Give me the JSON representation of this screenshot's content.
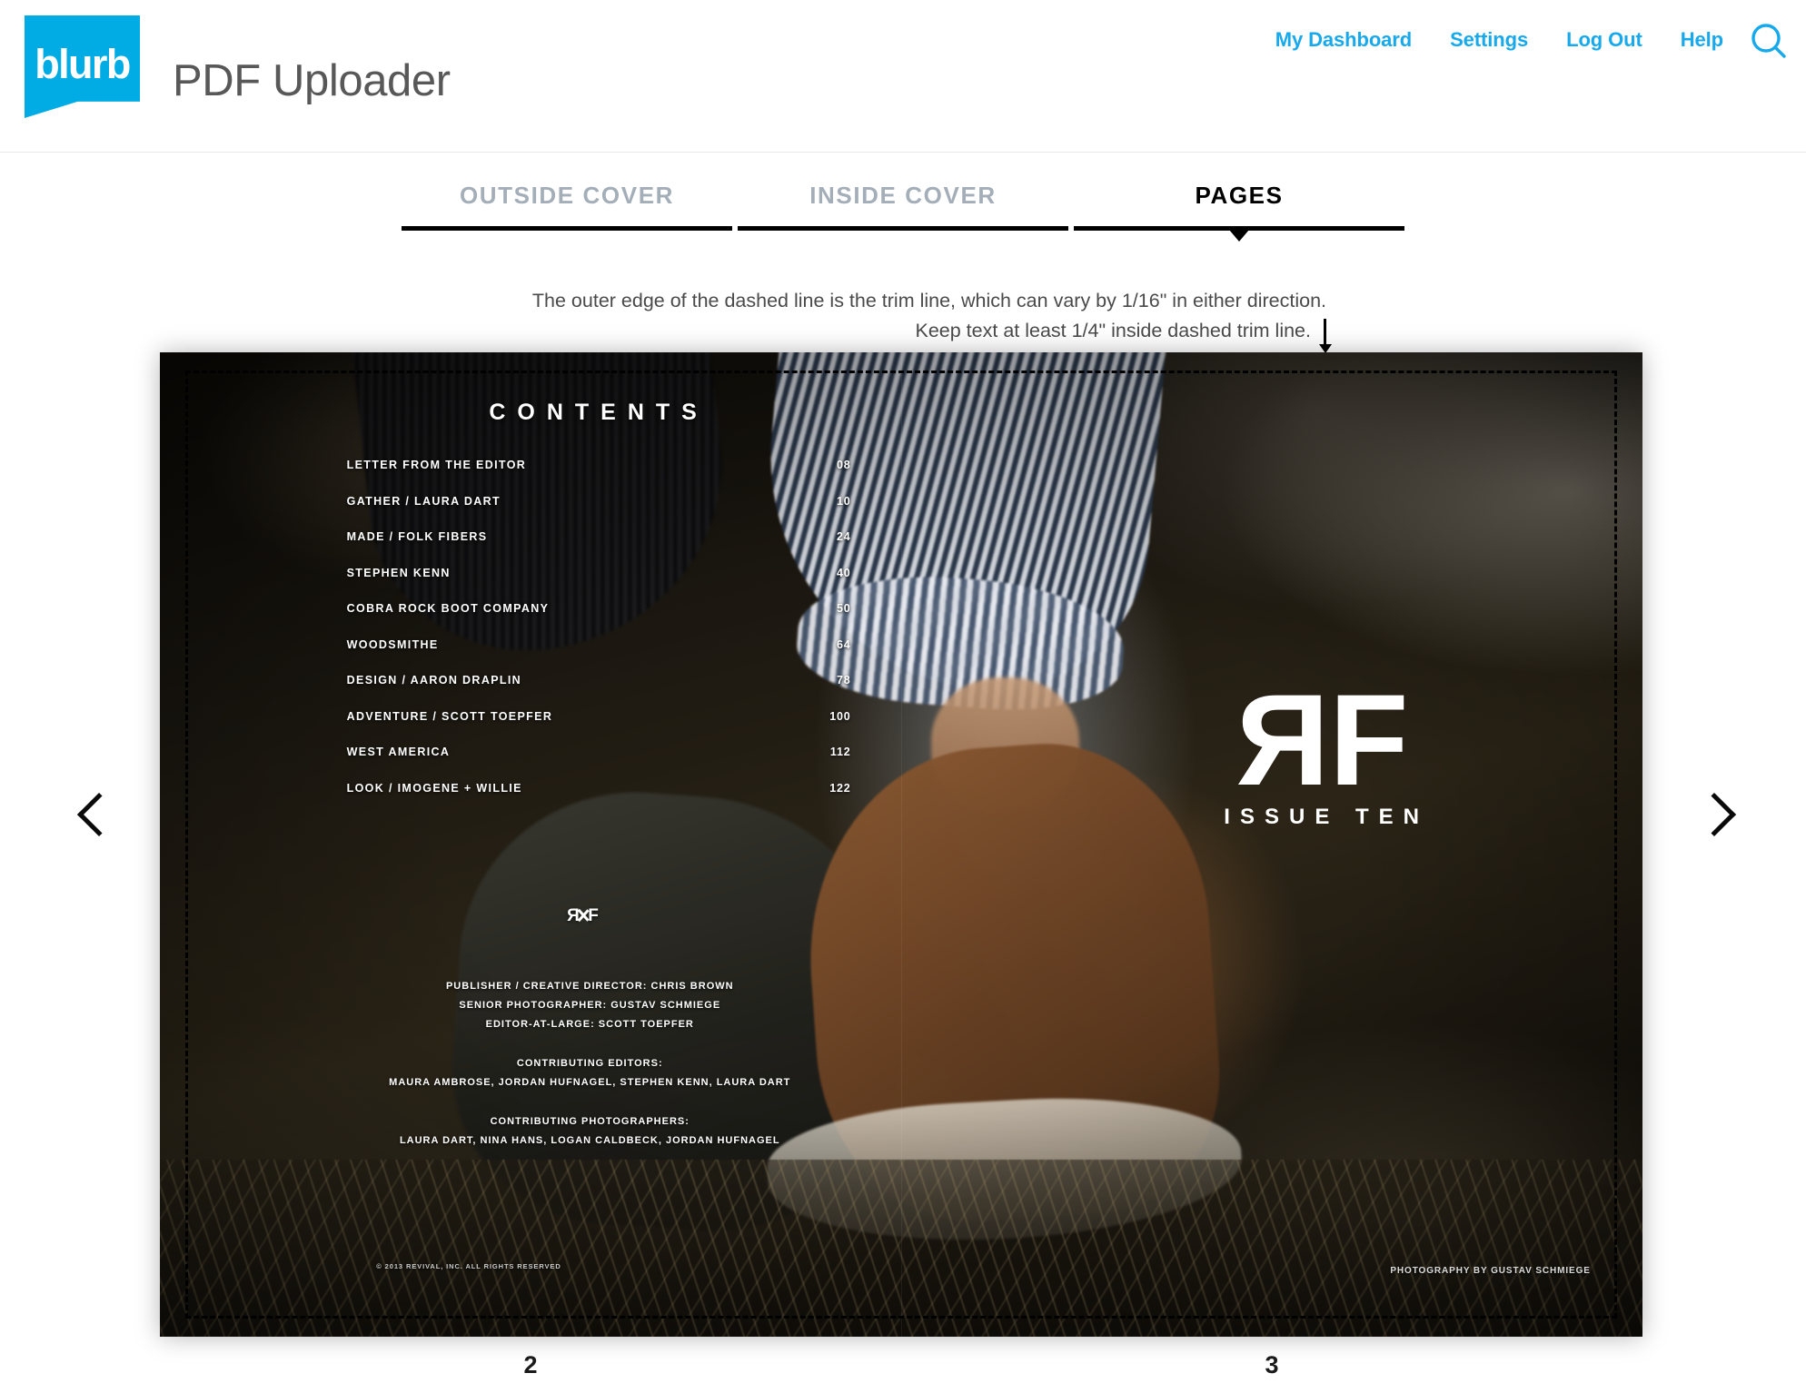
{
  "header": {
    "logo_text": "blurb",
    "app_title": "PDF Uploader",
    "nav": [
      {
        "label": "My Dashboard"
      },
      {
        "label": "Settings"
      },
      {
        "label": "Log Out"
      },
      {
        "label": "Help"
      }
    ],
    "search_icon": "search-icon",
    "accent_color": "#17a9ec",
    "logo_color": "#00ace3"
  },
  "tabs": [
    {
      "label": "OUTSIDE COVER",
      "active": false
    },
    {
      "label": "INSIDE COVER",
      "active": false
    },
    {
      "label": "PAGES",
      "active": true
    }
  ],
  "instructions": {
    "line1": "The outer edge of the dashed line is the trim line, which can vary by 1/16\" in either direction.",
    "line2": "Keep text at least 1/4\" inside dashed trim line.",
    "arrow_icon": "down-arrow-icon"
  },
  "spread": {
    "left_page": {
      "contents_title": "CONTENTS",
      "toc": [
        {
          "title": "LETTER FROM THE EDITOR",
          "page": "08"
        },
        {
          "title": "GATHER / LAURA DART",
          "page": "10"
        },
        {
          "title": "MADE / FOLK FIBERS",
          "page": "24"
        },
        {
          "title": "STEPHEN KENN",
          "page": "40"
        },
        {
          "title": "COBRA ROCK BOOT COMPANY",
          "page": "50"
        },
        {
          "title": "WOODSMITHE",
          "page": "64"
        },
        {
          "title": "DESIGN / AARON DRAPLIN",
          "page": "78"
        },
        {
          "title": "ADVENTURE / SCOTT TOEPFER",
          "page": "100"
        },
        {
          "title": "WEST AMERICA",
          "page": "112"
        },
        {
          "title": "LOOK / IMOGENE + WILLIE",
          "page": "122"
        }
      ],
      "monogram": "RF",
      "credits": {
        "publisher": "PUBLISHER / CREATIVE DIRECTOR: CHRIS BROWN",
        "senior_photographer": "SENIOR PHOTOGRAPHER: GUSTAV SCHMIEGE",
        "editor_at_large": "EDITOR-AT-LARGE: SCOTT TOEPFER",
        "contributing_editors_label": "CONTRIBUTING EDITORS:",
        "contributing_editors": "MAURA AMBROSE, JORDAN HUFNAGEL, STEPHEN KENN, LAURA DART",
        "contributing_photographers_label": "CONTRIBUTING PHOTOGRAPHERS:",
        "contributing_photographers": "LAURA DART, NINA HANS, LOGAN CALDBECK, JORDAN HUFNAGEL"
      },
      "copyright": "© 2013 REVIVAL, INC.   ALL RIGHTS RESERVED"
    },
    "right_page": {
      "logo_r": "R",
      "logo_f": "F",
      "issue": "ISSUE TEN",
      "photo_credit": "PHOTOGRAPHY BY GUSTAV SCHMIEGE"
    }
  },
  "navigation": {
    "prev_icon": "chevron-left-icon",
    "next_icon": "chevron-right-icon",
    "page_left": "2",
    "page_right": "3"
  }
}
